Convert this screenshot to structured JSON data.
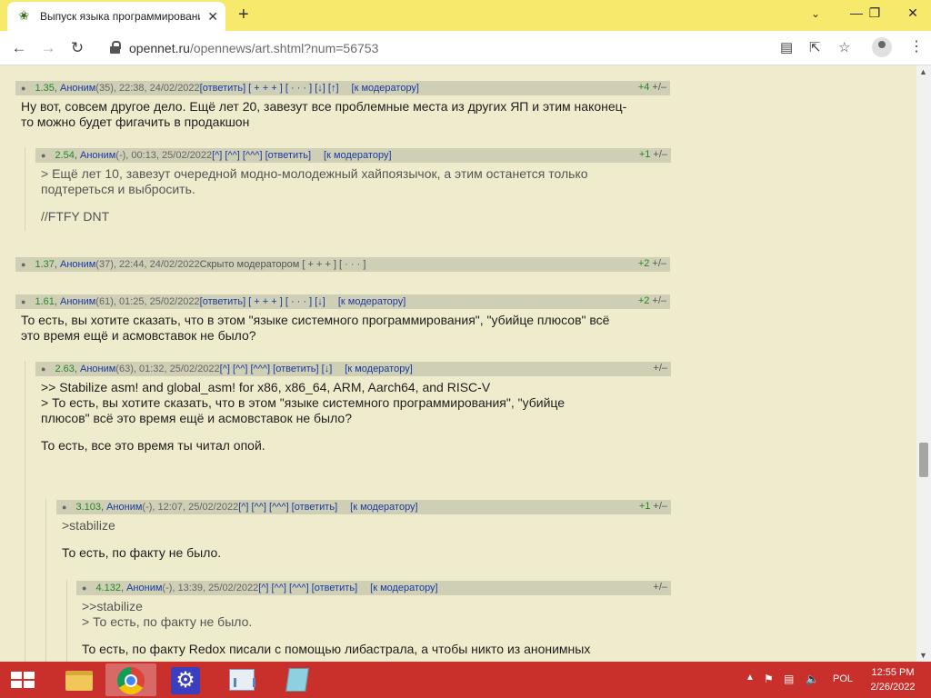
{
  "browser": {
    "tab_title": "Выпуск языка программирования",
    "url_host": "opennet.ru",
    "url_path": "/opennews/art.shtml?num=56753",
    "tab_close": "✕",
    "new_tab": "+",
    "tab_search": "⌄",
    "win_min": "—",
    "win_max": "❐",
    "win_close": "✕"
  },
  "comments": [
    {
      "num": "1.35",
      "author": "Аноним",
      "meta": " (35), 22:38, 24/02/2022 ",
      "links": "[ответить] [ + + + ] [ · · · ]  [↓] [↑]",
      "mod": "[к модератору]",
      "score": "+4",
      "lines": [
        "Ну вот, совсем другое дело. Ещё лет 20, завезут все проблемные места из других ЯП и этим наконец-",
        "то можно будет фигачить в продакшон"
      ]
    },
    {
      "num": "2.54",
      "author": "Аноним",
      "meta": " (-), 00:13, 25/02/2022 ",
      "links": "[^] [^^] [^^^] [ответить]",
      "mod": "[к модератору]",
      "score": "+1",
      "lines": [
        "> Ещё лет 10, завезут очередной модно-молодежный хайпоязычок, а этим останется только",
        "подтереться и выбросить."
      ],
      "extra": "//FTFY DNT"
    },
    {
      "num": "1.37",
      "author": "Аноним",
      "meta": " (37), 22:44, 24/02/2022 ",
      "links": "Скрыто модератором [ + + + ] [ · · · ]",
      "score": "+2"
    },
    {
      "num": "1.61",
      "author": "Аноним",
      "meta": " (61), 01:25, 25/02/2022 ",
      "links": "[ответить] [ + + + ] [ · · · ]  [↓]",
      "mod": "[к модератору]",
      "score": "+2",
      "lines": [
        "То есть, вы хотите сказать, что в этом \"языке системного программирования\", \"убийце плюсов\" всё",
        "это время ещё и асмовставок не было?"
      ]
    },
    {
      "num": "2.63",
      "author": "Аноним",
      "meta": " (63), 01:32, 25/02/2022 ",
      "links": "[^] [^^] [^^^] [ответить]  [↓]",
      "mod": "[к модератору]",
      "score": "",
      "lines": [
        ">> Stabilize asm! and global_asm! for x86, x86_64, ARM, Aarch64, and RISC-V",
        "> То есть, вы хотите сказать, что в этом \"языке системного программирования\", \"убийце",
        "плюсов\" всё это время ещё и асмовставок не было?"
      ],
      "extra": "То есть, все это время ты читал опой."
    },
    {
      "num": "3.103",
      "author": "Аноним",
      "meta": " (-), 12:07, 25/02/2022 ",
      "links": "[^] [^^] [^^^] [ответить]",
      "mod": "[к модератору]",
      "score": "+1",
      "lines": [
        ">stabilize"
      ],
      "extra": "То есть, по факту не было."
    },
    {
      "num": "4.132",
      "author": "Аноним",
      "meta": " (-), 13:39, 25/02/2022 ",
      "links": "[^] [^^] [^^^] [ответить]",
      "mod": "[к модератору]",
      "score": "",
      "lines": [
        ">>stabilize",
        "> То есть, по факту не было."
      ],
      "extra": "То есть, по факту Redox писали с помощью либастрала, а чтобы никто из анонимных"
    }
  ],
  "vote_label": "+/–",
  "taskbar": {
    "lang": "POL",
    "time": "12:55 PM",
    "date": "2/26/2022"
  },
  "colors": {
    "page_bg": "#eeeccc",
    "comment_bar": "#cfcfb6",
    "link": "#1a3aa0",
    "number": "#228822",
    "tabbar": "#f7e96c",
    "taskbar": "#c9302c"
  }
}
